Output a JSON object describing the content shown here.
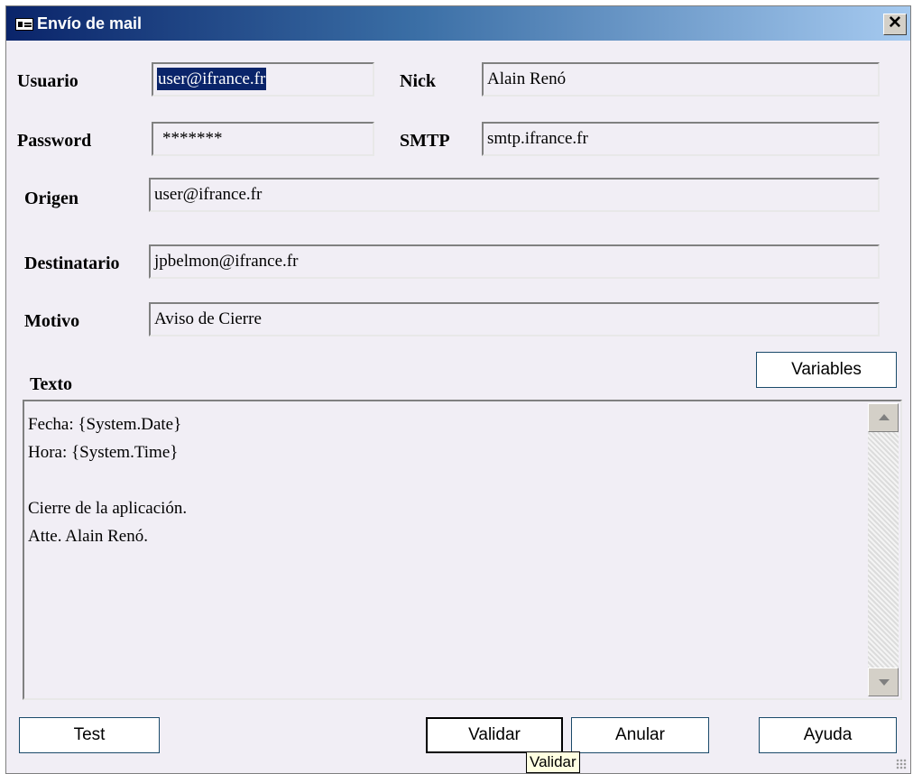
{
  "window": {
    "title": "Envío de mail",
    "close_label": "✕"
  },
  "fields": {
    "usuario": {
      "label": "Usuario",
      "value": "user@ifrance.fr"
    },
    "nick": {
      "label": "Nick",
      "value": "Alain Renó"
    },
    "password": {
      "label": "Password",
      "value": "*******"
    },
    "smtp": {
      "label": "SMTP",
      "value": "smtp.ifrance.fr"
    },
    "origen": {
      "label": "Origen",
      "value": "user@ifrance.fr"
    },
    "destinatario": {
      "label": "Destinatario",
      "value": "jpbelmon@ifrance.fr"
    },
    "motivo": {
      "label": "Motivo",
      "value": "Aviso de Cierre"
    }
  },
  "texto": {
    "label": "Texto",
    "content": "Fecha: {System.Date}\nHora: {System.Time}\n\nCierre de la aplicación.\nAtte. Alain Renó."
  },
  "buttons": {
    "variables": "Variables",
    "test": "Test",
    "validar": "Validar",
    "anular": "Anular",
    "ayuda": "Ayuda"
  },
  "tooltip": "Validar",
  "colors": {
    "titlebar_start": "#0a246a",
    "titlebar_end": "#a6caf0",
    "background": "#f1eef5",
    "selection": "#0a246a"
  }
}
